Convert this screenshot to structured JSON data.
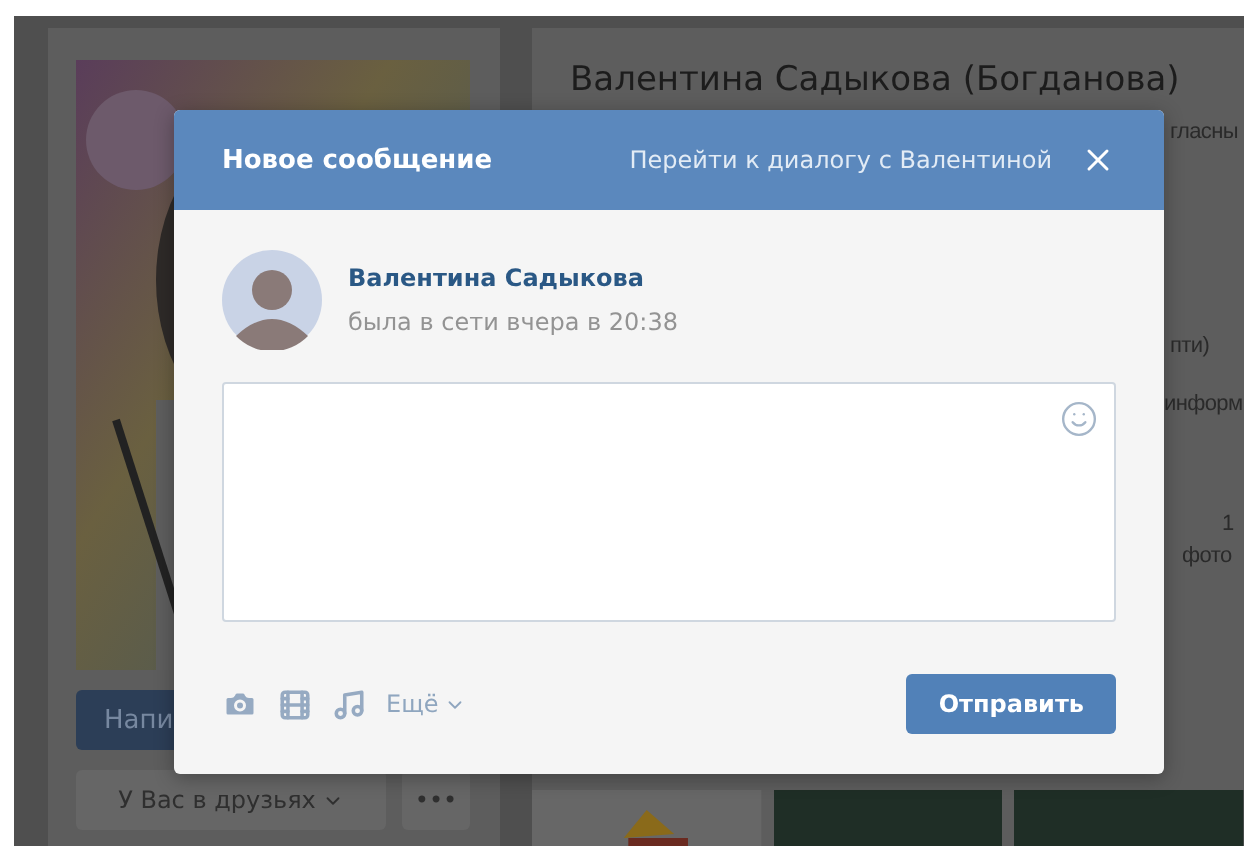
{
  "background": {
    "title": "Валентина Садыкова (Богданова)",
    "fragments": [
      "гласны",
      "пти)",
      "информ"
    ],
    "count": "1",
    "count_label": "фото",
    "write_button": "Напи",
    "friends_button": "У Вас в друзьях",
    "more_button": "•••"
  },
  "dialog": {
    "title": "Новое сообщение",
    "link": "Перейти к диалогу с Валентиной",
    "contact": {
      "name": "Валентина Садыкова",
      "status": "была в сети вчера в 20:38"
    },
    "more": "Ещё",
    "send": "Отправить"
  }
}
